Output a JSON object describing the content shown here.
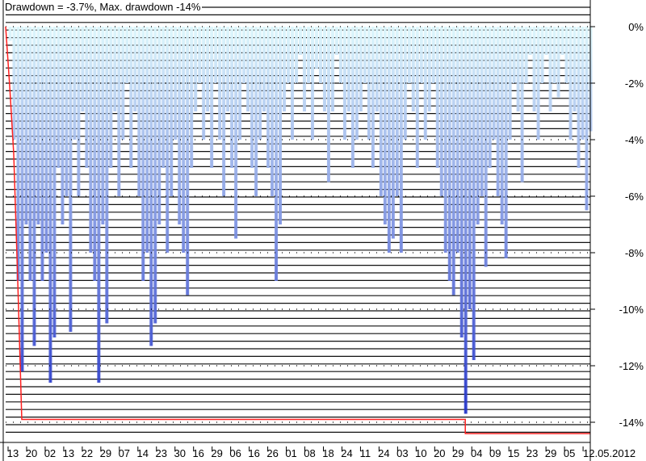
{
  "title": "Drawdown = -3.7%, Max. drawdown -14%",
  "colors": {
    "bar_top": "#dcf7fc",
    "bar_bottom": "#2030c8",
    "max_drawdown_line": "#ff2020",
    "grid": "#000000"
  },
  "chart_data": {
    "type": "bar",
    "title": "Drawdown = -3.7%, Max. drawdown -14%",
    "ylabel": "",
    "xlabel": "",
    "ylim": [
      -14.5,
      0
    ],
    "y_ticks": [
      0,
      -2,
      -4,
      -6,
      -8,
      -10,
      -12,
      -14
    ],
    "y_tick_labels": [
      "0%",
      "-2%",
      "-4%",
      "-6%",
      "-8%",
      "-10%",
      "-12%",
      "-14%"
    ],
    "x_tick_labels": [
      "13",
      "20",
      "02",
      "13",
      "22",
      "29",
      "07",
      "14",
      "23",
      "30",
      "16",
      "29",
      "06",
      "16",
      "26",
      "01",
      "08",
      "18",
      "24",
      "11",
      "24",
      "03",
      "10",
      "20",
      "29",
      "04",
      "09",
      "15",
      "23",
      "29",
      "05",
      "12.05.2012"
    ],
    "grid": true,
    "series": [
      {
        "name": "Drawdown",
        "values": [
          0,
          -0.5,
          -4,
          -9,
          -12.2,
          -7,
          -9,
          -11.3,
          -7,
          -9,
          -8,
          -12.6,
          -11,
          -5,
          -7,
          -6,
          -10.8,
          -4,
          -6,
          -3,
          -5,
          -8,
          -9,
          -12.6,
          -7,
          -10.5,
          -5,
          -3,
          -6,
          -4,
          -2,
          -5,
          -3,
          -6,
          -9,
          -8,
          -11.3,
          -10.5,
          -7,
          -5,
          -8,
          -6,
          -4,
          -7,
          -8,
          -9.5,
          -5,
          -3,
          -2,
          -4,
          -3,
          -5,
          -2,
          -4,
          -6,
          -3,
          -5,
          -7.5,
          -4,
          -2,
          -3,
          -5,
          -6,
          -4,
          -3,
          -5,
          -6,
          -9,
          -7,
          -3,
          -2,
          -4,
          -2,
          -1,
          -3,
          -2,
          -4,
          -1.5,
          -2,
          -3,
          -5.5,
          -3,
          -1,
          -2,
          -4,
          -3,
          -5,
          -4,
          -3,
          -2,
          -4,
          -5,
          -3,
          -6,
          -7,
          -8,
          -7.5,
          -6,
          -8,
          -4,
          -2,
          -3,
          -5,
          -2,
          -4,
          -3,
          -2,
          -5,
          -6,
          -8,
          -9,
          -9.5,
          -8,
          -11,
          -13.7,
          -10,
          -11.8,
          -7,
          -6,
          -8.5,
          -5,
          -4,
          -6,
          -7,
          -8.2,
          -4,
          -2,
          -3,
          -5.5,
          -2,
          -1,
          -3,
          -4,
          -2,
          -1,
          -3,
          -2,
          -2.5,
          -1,
          -2,
          -4,
          -3,
          -5,
          -4,
          -6.5,
          -3.7
        ]
      },
      {
        "name": "Max. drawdown",
        "steps": [
          [
            0,
            0
          ],
          [
            1,
            -2.1
          ],
          [
            2,
            -4.5
          ],
          [
            3,
            -9
          ],
          [
            4,
            -13.9
          ],
          [
            114,
            -13.9
          ],
          [
            114,
            -14.4
          ],
          [
            145,
            -14.4
          ]
        ]
      }
    ]
  }
}
